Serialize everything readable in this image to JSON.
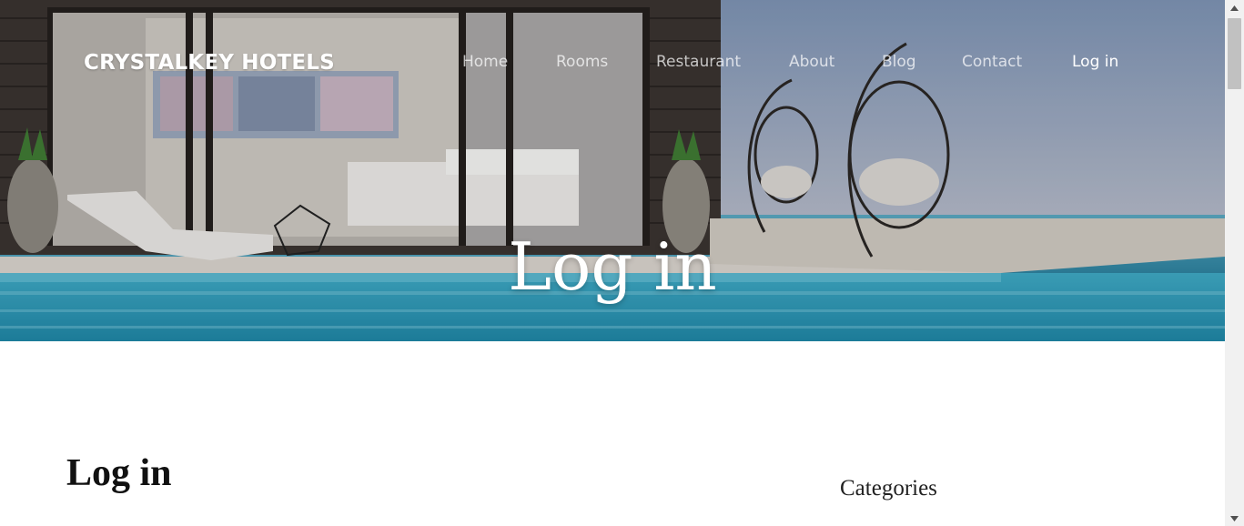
{
  "brand": {
    "name": "CRYSTALKEY HOTELS"
  },
  "nav": {
    "items": [
      {
        "label": "Home",
        "active": false
      },
      {
        "label": "Rooms",
        "active": false
      },
      {
        "label": "Restaurant",
        "active": false
      },
      {
        "label": "About",
        "active": false
      },
      {
        "label": "Blog",
        "active": false
      },
      {
        "label": "Contact",
        "active": false
      },
      {
        "label": "Log in",
        "active": true
      }
    ]
  },
  "hero": {
    "title": "Log in"
  },
  "main": {
    "title": "Log in"
  },
  "sidebar": {
    "heading": "Categories"
  },
  "colors": {
    "nav_text": "#ffffff",
    "pool_water": "#2e8fae",
    "sky": "#8aa0bd"
  }
}
